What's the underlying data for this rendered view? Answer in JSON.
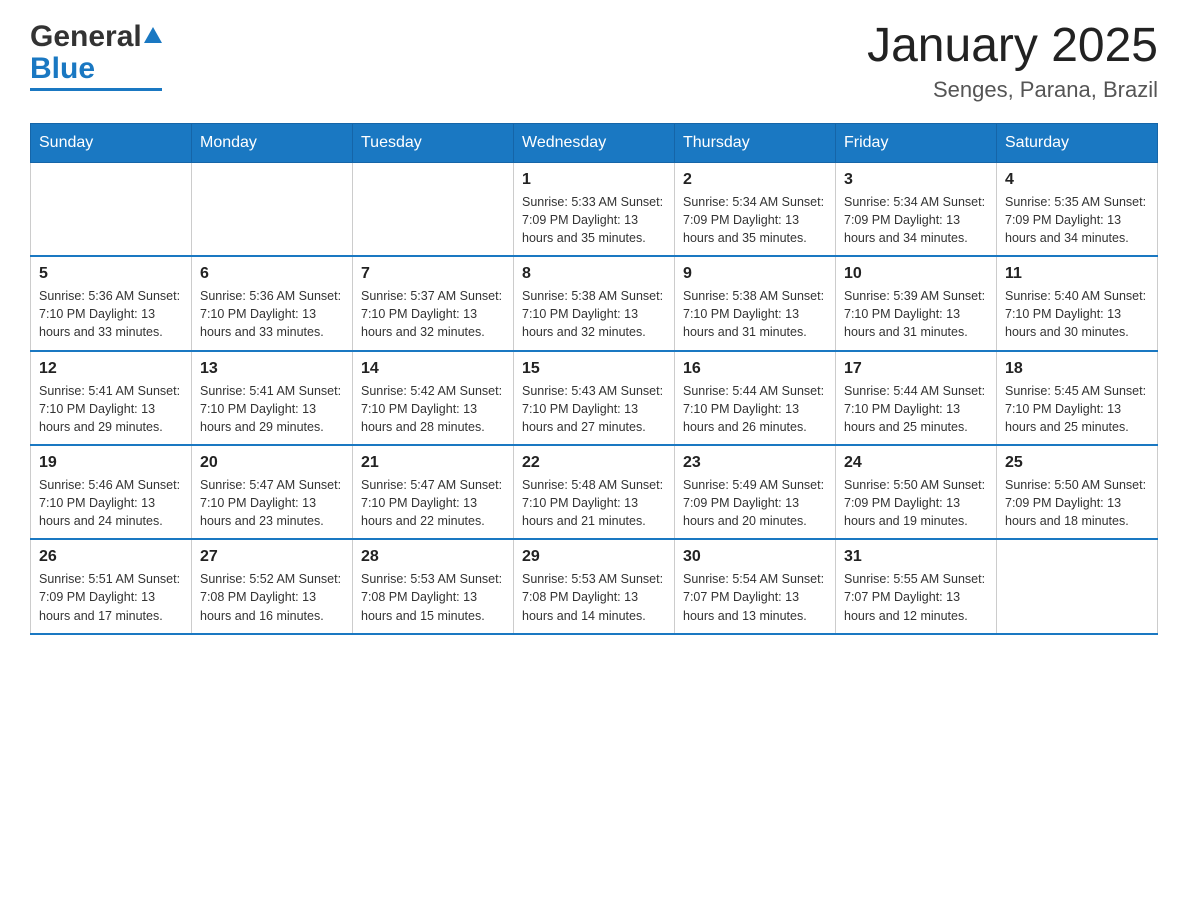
{
  "header": {
    "logo_general": "General",
    "logo_blue": "Blue",
    "title": "January 2025",
    "subtitle": "Senges, Parana, Brazil"
  },
  "calendar": {
    "days_of_week": [
      "Sunday",
      "Monday",
      "Tuesday",
      "Wednesday",
      "Thursday",
      "Friday",
      "Saturday"
    ],
    "weeks": [
      [
        {
          "day": "",
          "info": ""
        },
        {
          "day": "",
          "info": ""
        },
        {
          "day": "",
          "info": ""
        },
        {
          "day": "1",
          "info": "Sunrise: 5:33 AM\nSunset: 7:09 PM\nDaylight: 13 hours\nand 35 minutes."
        },
        {
          "day": "2",
          "info": "Sunrise: 5:34 AM\nSunset: 7:09 PM\nDaylight: 13 hours\nand 35 minutes."
        },
        {
          "day": "3",
          "info": "Sunrise: 5:34 AM\nSunset: 7:09 PM\nDaylight: 13 hours\nand 34 minutes."
        },
        {
          "day": "4",
          "info": "Sunrise: 5:35 AM\nSunset: 7:09 PM\nDaylight: 13 hours\nand 34 minutes."
        }
      ],
      [
        {
          "day": "5",
          "info": "Sunrise: 5:36 AM\nSunset: 7:10 PM\nDaylight: 13 hours\nand 33 minutes."
        },
        {
          "day": "6",
          "info": "Sunrise: 5:36 AM\nSunset: 7:10 PM\nDaylight: 13 hours\nand 33 minutes."
        },
        {
          "day": "7",
          "info": "Sunrise: 5:37 AM\nSunset: 7:10 PM\nDaylight: 13 hours\nand 32 minutes."
        },
        {
          "day": "8",
          "info": "Sunrise: 5:38 AM\nSunset: 7:10 PM\nDaylight: 13 hours\nand 32 minutes."
        },
        {
          "day": "9",
          "info": "Sunrise: 5:38 AM\nSunset: 7:10 PM\nDaylight: 13 hours\nand 31 minutes."
        },
        {
          "day": "10",
          "info": "Sunrise: 5:39 AM\nSunset: 7:10 PM\nDaylight: 13 hours\nand 31 minutes."
        },
        {
          "day": "11",
          "info": "Sunrise: 5:40 AM\nSunset: 7:10 PM\nDaylight: 13 hours\nand 30 minutes."
        }
      ],
      [
        {
          "day": "12",
          "info": "Sunrise: 5:41 AM\nSunset: 7:10 PM\nDaylight: 13 hours\nand 29 minutes."
        },
        {
          "day": "13",
          "info": "Sunrise: 5:41 AM\nSunset: 7:10 PM\nDaylight: 13 hours\nand 29 minutes."
        },
        {
          "day": "14",
          "info": "Sunrise: 5:42 AM\nSunset: 7:10 PM\nDaylight: 13 hours\nand 28 minutes."
        },
        {
          "day": "15",
          "info": "Sunrise: 5:43 AM\nSunset: 7:10 PM\nDaylight: 13 hours\nand 27 minutes."
        },
        {
          "day": "16",
          "info": "Sunrise: 5:44 AM\nSunset: 7:10 PM\nDaylight: 13 hours\nand 26 minutes."
        },
        {
          "day": "17",
          "info": "Sunrise: 5:44 AM\nSunset: 7:10 PM\nDaylight: 13 hours\nand 25 minutes."
        },
        {
          "day": "18",
          "info": "Sunrise: 5:45 AM\nSunset: 7:10 PM\nDaylight: 13 hours\nand 25 minutes."
        }
      ],
      [
        {
          "day": "19",
          "info": "Sunrise: 5:46 AM\nSunset: 7:10 PM\nDaylight: 13 hours\nand 24 minutes."
        },
        {
          "day": "20",
          "info": "Sunrise: 5:47 AM\nSunset: 7:10 PM\nDaylight: 13 hours\nand 23 minutes."
        },
        {
          "day": "21",
          "info": "Sunrise: 5:47 AM\nSunset: 7:10 PM\nDaylight: 13 hours\nand 22 minutes."
        },
        {
          "day": "22",
          "info": "Sunrise: 5:48 AM\nSunset: 7:10 PM\nDaylight: 13 hours\nand 21 minutes."
        },
        {
          "day": "23",
          "info": "Sunrise: 5:49 AM\nSunset: 7:09 PM\nDaylight: 13 hours\nand 20 minutes."
        },
        {
          "day": "24",
          "info": "Sunrise: 5:50 AM\nSunset: 7:09 PM\nDaylight: 13 hours\nand 19 minutes."
        },
        {
          "day": "25",
          "info": "Sunrise: 5:50 AM\nSunset: 7:09 PM\nDaylight: 13 hours\nand 18 minutes."
        }
      ],
      [
        {
          "day": "26",
          "info": "Sunrise: 5:51 AM\nSunset: 7:09 PM\nDaylight: 13 hours\nand 17 minutes."
        },
        {
          "day": "27",
          "info": "Sunrise: 5:52 AM\nSunset: 7:08 PM\nDaylight: 13 hours\nand 16 minutes."
        },
        {
          "day": "28",
          "info": "Sunrise: 5:53 AM\nSunset: 7:08 PM\nDaylight: 13 hours\nand 15 minutes."
        },
        {
          "day": "29",
          "info": "Sunrise: 5:53 AM\nSunset: 7:08 PM\nDaylight: 13 hours\nand 14 minutes."
        },
        {
          "day": "30",
          "info": "Sunrise: 5:54 AM\nSunset: 7:07 PM\nDaylight: 13 hours\nand 13 minutes."
        },
        {
          "day": "31",
          "info": "Sunrise: 5:55 AM\nSunset: 7:07 PM\nDaylight: 13 hours\nand 12 minutes."
        },
        {
          "day": "",
          "info": ""
        }
      ]
    ]
  }
}
